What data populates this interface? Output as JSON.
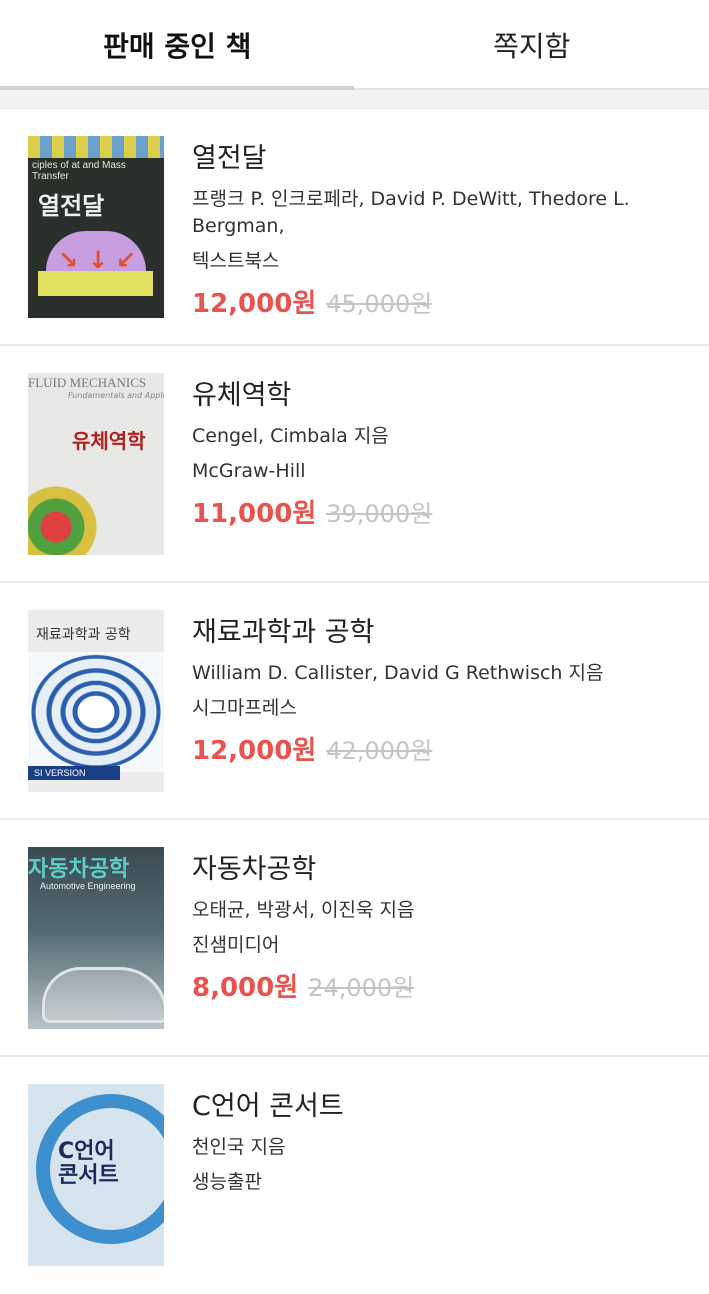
{
  "tabs": [
    {
      "label": "판매 중인 책",
      "active": true
    },
    {
      "label": "쪽지함",
      "active": false
    }
  ],
  "books": [
    {
      "title": "열전달",
      "author": "프랭크 P. 인크로페라, David P. DeWitt, Thedore L. Bergman,",
      "publisher": "텍스트북스",
      "price": "12,000원",
      "original_price": "45,000원",
      "cover_text": {
        "line1": "ciples of at and Mass Transfer",
        "line2": "열전달"
      }
    },
    {
      "title": "유체역학",
      "author": "Cengel, Cimbala 지음",
      "publisher": "McGraw-Hill",
      "price": "11,000원",
      "original_price": "39,000원",
      "cover_text": {
        "line1": "FLUID MECHANICS",
        "line2": "Fundamentals and Applications",
        "line3": "유체역학"
      }
    },
    {
      "title": "재료과학과 공학",
      "author": "William D. Callister, David G Rethwisch 지음",
      "publisher": "시그마프레스",
      "price": "12,000원",
      "original_price": "42,000원",
      "cover_text": {
        "line1": "재료과학과 공학",
        "line2": "SI VERSION"
      }
    },
    {
      "title": "자동차공학",
      "author": "오태균, 박광서, 이진욱 지음",
      "publisher": "진샘미디어",
      "price": "8,000원",
      "original_price": "24,000원",
      "cover_text": {
        "line1": "자동차공학",
        "line2": "Automotive Engineering"
      }
    },
    {
      "title": "C언어 콘서트",
      "author": "천인국 지음",
      "publisher": "생능출판",
      "cover_text": {
        "line1": "C언어",
        "line2": "콘서트"
      }
    }
  ],
  "colors": {
    "price": "#e8534e",
    "original_price": "#c4c4c4"
  }
}
